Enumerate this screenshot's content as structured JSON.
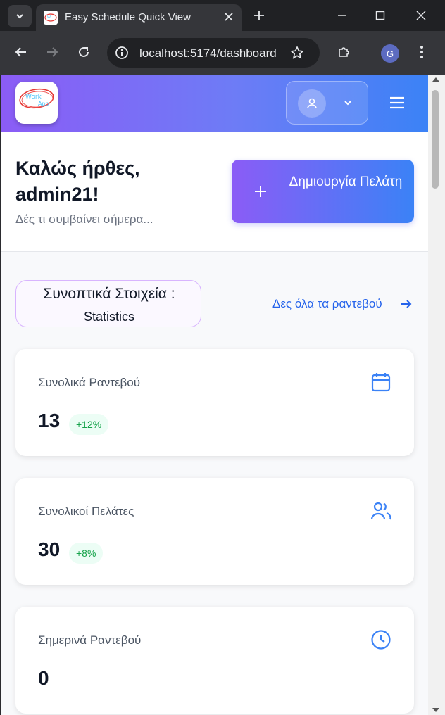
{
  "browser": {
    "tab_title": "Easy Schedule Quick View",
    "url": "localhost:5174/dashboard",
    "profile_initial": "G"
  },
  "header": {
    "logo_text_line1": "Work",
    "logo_text_line2": "App"
  },
  "welcome": {
    "title": "Καλώς ήρθες, admin21!",
    "subtitle": "Δές τι συμβαίνει σήμερα...",
    "create_button": "Δημιουργία Πελάτη"
  },
  "stats": {
    "title": "Συνοπτικά Στοιχεία :",
    "subtitle": "Statistics",
    "see_all": "Δες όλα τα ραντεβού"
  },
  "cards": [
    {
      "label": "Συνολικά Ραντεβού",
      "value": "13",
      "delta": "+12%",
      "icon": "calendar-icon"
    },
    {
      "label": "Συνολικοί Πελάτες",
      "value": "30",
      "delta": "+8%",
      "icon": "users-icon"
    },
    {
      "label": "Σημερινά Ραντεβού",
      "value": "0",
      "delta": "",
      "icon": "clock-icon"
    }
  ],
  "colors": {
    "accent_purple": "#8b5cf6",
    "accent_blue": "#3b82f6",
    "link_blue": "#2563eb",
    "positive_green": "#16a34a"
  }
}
